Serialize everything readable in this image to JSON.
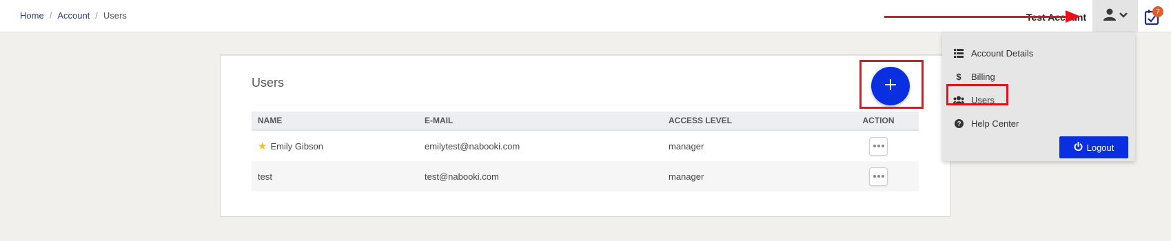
{
  "breadcrumb": {
    "items": [
      "Home",
      "Account",
      "Users"
    ],
    "separator": "/"
  },
  "header": {
    "account_name": "Test Account",
    "notification_count": "7"
  },
  "card": {
    "title": "Users",
    "add_button_label": "+"
  },
  "table": {
    "columns": [
      "NAME",
      "E-MAIL",
      "ACCESS LEVEL",
      "ACTION"
    ],
    "rows": [
      {
        "name": "Emily Gibson",
        "email": "emilytest@nabooki.com",
        "access": "manager",
        "starred": true
      },
      {
        "name": "test",
        "email": "test@nabooki.com",
        "access": "manager",
        "starred": false
      }
    ]
  },
  "dropdown": {
    "items": [
      {
        "label": "Account Details",
        "icon": "list-icon"
      },
      {
        "label": "Billing",
        "icon": "dollar-icon"
      },
      {
        "label": "Users",
        "icon": "users-icon"
      },
      {
        "label": "Help Center",
        "icon": "question-circle-icon"
      }
    ],
    "logout_label": "Logout"
  },
  "colors": {
    "primary": "#0a2fe0",
    "annotation": "#e8101a",
    "badge": "#e35d2c",
    "star": "#f2c21b"
  }
}
